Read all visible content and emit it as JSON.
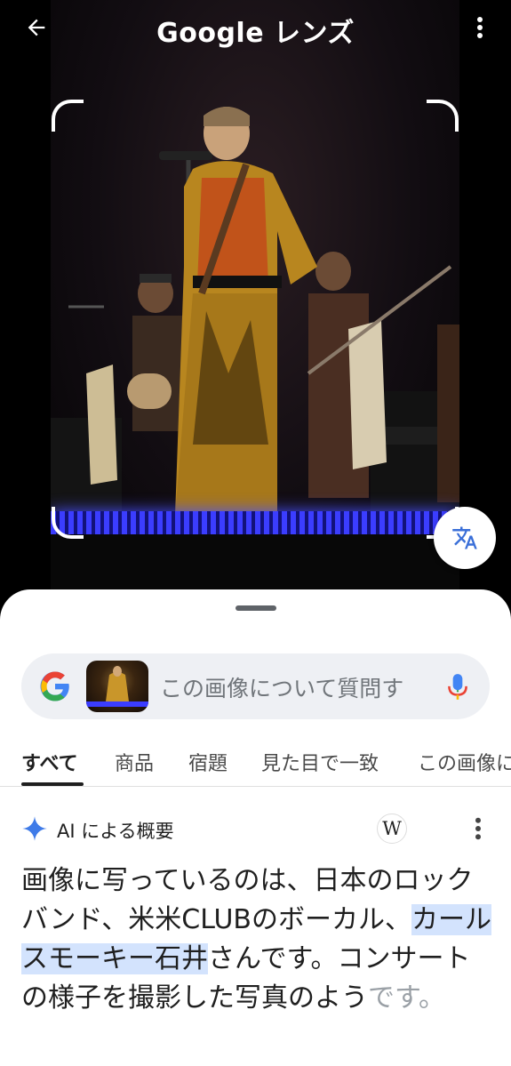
{
  "header": {
    "title": "Google レンズ",
    "back_icon": "arrow-left-icon",
    "menu_icon": "more-vert-icon"
  },
  "photo": {
    "description_icon": "concert-photo",
    "translate_icon": "translate-icon"
  },
  "search": {
    "placeholder": "この画像について質問す",
    "logo_icon": "google-g-icon",
    "mic_icon": "mic-icon"
  },
  "tabs": [
    {
      "label": "すべて",
      "active": true
    },
    {
      "label": "商品",
      "active": false
    },
    {
      "label": "宿題",
      "active": false
    },
    {
      "label": "見た目で一致",
      "active": false
    },
    {
      "label": "この画像に",
      "active": false
    }
  ],
  "ai_overview": {
    "label": "AI による概要",
    "source_badge": "W",
    "sparkle_icon": "sparkle-icon",
    "menu_icon": "more-vert-icon",
    "text_part1": "画像に写っているのは、日本のロックバンド、米米CLUBのボーカル、",
    "highlight": "カールスモーキー石井",
    "text_part2": "さんです。コンサートの様子を撮影した写真のよう",
    "text_fade": "です。"
  },
  "colors": {
    "accent_blue": "#4285f4",
    "highlight_bg": "#d3e3fd",
    "stage_light": "#3b3dff"
  }
}
